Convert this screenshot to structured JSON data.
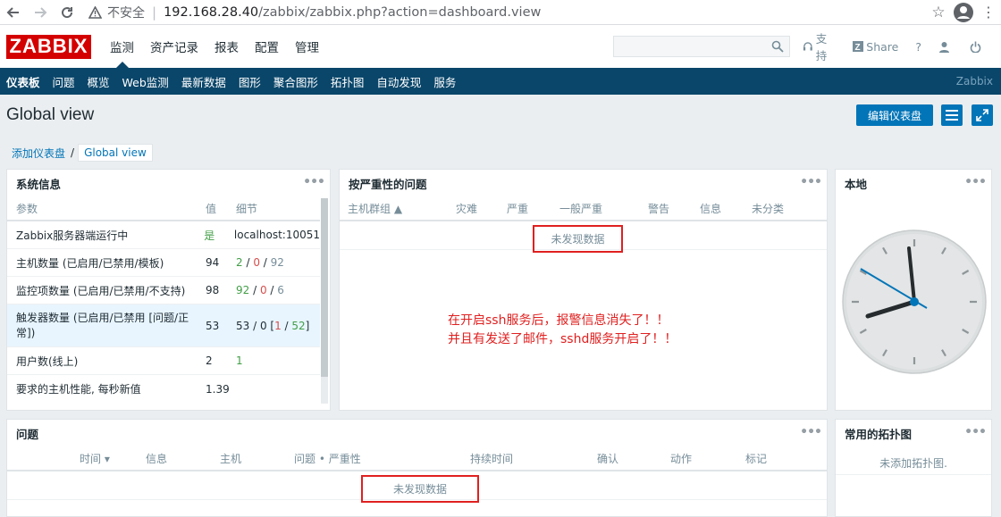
{
  "browser": {
    "insecure_label": "不安全",
    "url_host": "192.168.28.40",
    "url_path": "/zabbix/zabbix.php?action=dashboard.view"
  },
  "header": {
    "logo": "ZABBIX",
    "menu": [
      "监测",
      "资产记录",
      "报表",
      "配置",
      "管理"
    ],
    "search_placeholder": "",
    "support": "支持",
    "share": "Share",
    "help": "?"
  },
  "subnav": {
    "items": [
      "仪表板",
      "问题",
      "概览",
      "Web监测",
      "最新数据",
      "图形",
      "聚合图形",
      "拓扑图",
      "自动发现",
      "服务"
    ],
    "brand": "Zabbix"
  },
  "page": {
    "title": "Global view",
    "edit_button": "编辑仪表盘",
    "breadcrumb": [
      "添加仪表盘",
      "Global view"
    ]
  },
  "sysinfo": {
    "title": "系统信息",
    "headers": [
      "参数",
      "值",
      "细节"
    ],
    "rows": [
      {
        "param": "Zabbix服务器端运行中",
        "value": "是",
        "detail": "localhost:10051"
      },
      {
        "param": "主机数量 (已启用/已禁用/模板)",
        "value": "94",
        "d1": "2",
        "d2": "0",
        "d3": "92"
      },
      {
        "param": "监控项数量 (已启用/已禁用/不支持)",
        "value": "98",
        "d1": "92",
        "d2": "0",
        "d3": "6"
      },
      {
        "param": "触发器数量 (已启用/已禁用 [问题/正常])",
        "value": "53",
        "d1": "53 / 0 [",
        "d2": "1",
        "d3": "52",
        "d4": "]"
      },
      {
        "param": "用户数(线上)",
        "value": "2",
        "detail": "1"
      },
      {
        "param": "要求的主机性能, 每秒新值",
        "value": "1.39",
        "detail": ""
      }
    ]
  },
  "severity": {
    "title": "按严重性的问题",
    "headers": [
      "主机群组 ▲",
      "灾难",
      "严重",
      "一般严重",
      "警告",
      "信息",
      "未分类"
    ],
    "no_data": "未发现数据"
  },
  "annotation": {
    "line1": "在开启ssh服务后，报警信息消失了！！",
    "line2": "并且有发送了邮件，sshd服务开启了！！"
  },
  "clock": {
    "title": "本地"
  },
  "problems": {
    "title": "问题",
    "headers": [
      "时间 ▾",
      "信息",
      "主机",
      "问题 • 严重性",
      "持续时间",
      "确认",
      "动作",
      "标记"
    ],
    "no_data": "未发现数据"
  },
  "maps": {
    "title": "常用的拓扑图",
    "empty": "未添加拓扑图."
  },
  "colors": {
    "accent": "#0275b8",
    "nav": "#0a466a",
    "logo": "#d40000",
    "highlight": "#e02020"
  }
}
